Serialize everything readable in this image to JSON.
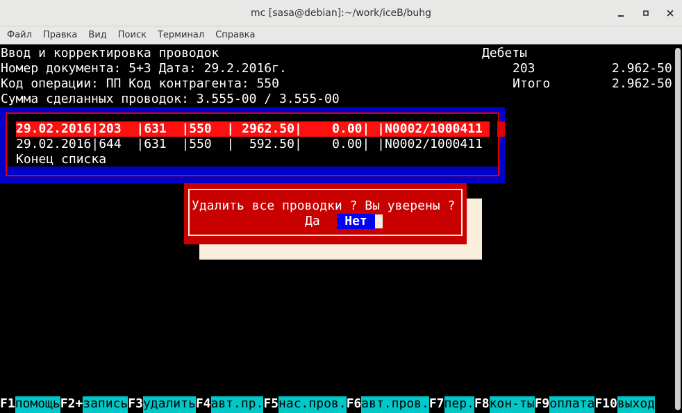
{
  "window": {
    "title": "mc [sasa@debian]:~/work/iceB/buhg"
  },
  "menu": [
    "Файл",
    "Правка",
    "Вид",
    "Поиск",
    "Терминал",
    "Справка"
  ],
  "header": {
    "line1": "Ввод и корректировка проводок",
    "line2": "Номер документа: 5+3 Дата: 29.2.2016г.",
    "line3": "Код операции: ПП Код контрагента: 550",
    "line4": "Сумма сделанных проводок: 3.555-00 / 3.555-00"
  },
  "debits": {
    "title": "Дебеты",
    "account": "203",
    "account_value": "2.962-50",
    "total_label": "Итого",
    "total_value": "2.962-50"
  },
  "list": {
    "rows": [
      "29.02.2016|203  |631  |550  | 2962.50|    0.00| |N0002/1000411",
      "29.02.2016|644  |631  |550  |  592.50|    0.00| |N0002/1000411"
    ],
    "end_label": "Конец списка"
  },
  "dialog": {
    "message": "Удалить все проводки ? Вы уверены ?",
    "yes_label": "Да",
    "no_label": "Нет"
  },
  "fkeys": [
    {
      "key": "F1",
      "label": "помощь"
    },
    {
      "key": "F2+",
      "label": "запись"
    },
    {
      "key": "F3",
      "label": "удалить"
    },
    {
      "key": "F4",
      "label": "авт.пр."
    },
    {
      "key": "F5",
      "label": "нас.пров."
    },
    {
      "key": "F6",
      "label": "авт.пров."
    },
    {
      "key": "F7",
      "label": "пер."
    },
    {
      "key": "F8",
      "label": "кон-ты"
    },
    {
      "key": "F9",
      "label": "оплата"
    },
    {
      "key": "F10",
      "label": "выход"
    }
  ],
  "colors": {
    "terminal_bg": "#000000",
    "list_frame": "#0000c8",
    "selection": "#ff1010",
    "dialog_bg": "#c80000",
    "button_active": "#0000ff",
    "fkey_label_bg": "#00c8c8"
  }
}
